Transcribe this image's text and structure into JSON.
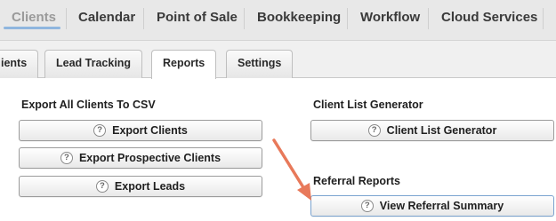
{
  "topnav": {
    "items": [
      "Clients",
      "Calendar",
      "Point of Sale",
      "Bookkeeping",
      "Workflow",
      "Cloud Services"
    ],
    "active_index": 0
  },
  "subtabs": {
    "items": [
      "ients",
      "Lead Tracking",
      "Reports",
      "Settings"
    ],
    "active_index": 2
  },
  "left": {
    "heading": "Export All Clients To CSV",
    "buttons": [
      "Export Clients",
      "Export Prospective Clients",
      "Export Leads"
    ]
  },
  "right": {
    "client_list_heading": "Client List Generator",
    "client_list_button": "Client List Generator",
    "referral_heading": "Referral Reports",
    "referral_button": "View Referral Summary"
  },
  "help_glyph": "?",
  "colors": {
    "active_underline": "#8fb6df",
    "annotation_arrow": "#e8795a"
  }
}
